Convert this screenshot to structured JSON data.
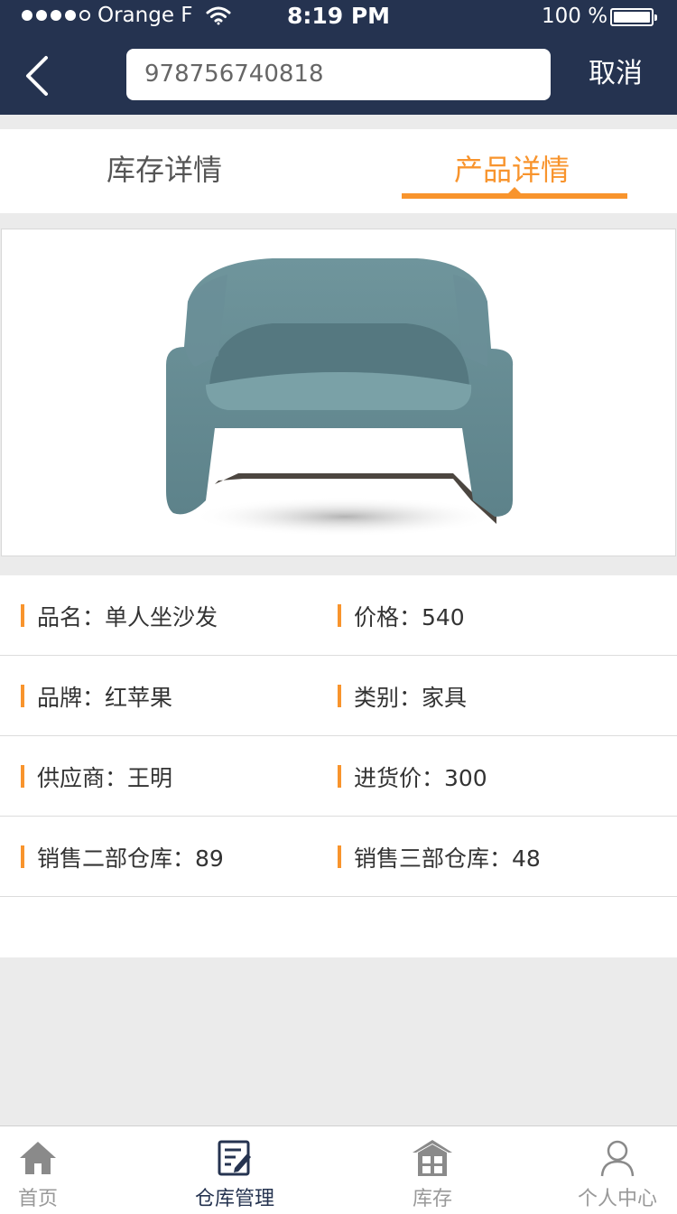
{
  "status_bar": {
    "carrier": "Orange F",
    "time": "8:19 PM",
    "battery": "100 %"
  },
  "header": {
    "search_value": "978756740818",
    "cancel_label": "取消",
    "back_icon": "chevron-left-icon"
  },
  "tabs": [
    {
      "label": "库存详情",
      "active": false
    },
    {
      "label": "产品详情",
      "active": true
    }
  ],
  "product_image": "armchair-photo",
  "details": [
    {
      "left": "品名：单人坐沙发",
      "right": "价格：540"
    },
    {
      "left": "品牌：红苹果",
      "right": "类别：家具"
    },
    {
      "left": "供应商：王明",
      "right": "进货价：300"
    },
    {
      "left": "销售二部仓库：89",
      "right": "销售三部仓库：48"
    }
  ],
  "tabbar": [
    {
      "label": "首页",
      "icon": "home-icon",
      "active": false
    },
    {
      "label": "仓库管理",
      "icon": "edit-document-icon",
      "active": true
    },
    {
      "label": "库存",
      "icon": "warehouse-icon",
      "active": false
    },
    {
      "label": "个人中心",
      "icon": "user-icon",
      "active": false
    }
  ],
  "colors": {
    "header_bg": "#253350",
    "accent": "#f8942d",
    "page_bg": "#ebebeb"
  }
}
